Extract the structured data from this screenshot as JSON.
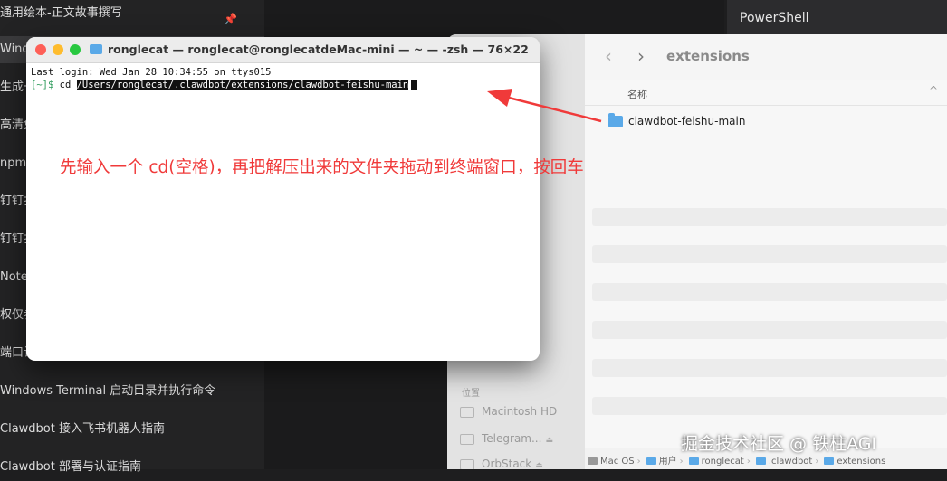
{
  "left_panel": {
    "items": [
      {
        "label": "通用绘本-正文故事撰写"
      },
      {
        "label": "Wind"
      },
      {
        "label": "生成一"
      },
      {
        "label": "高清免"
      },
      {
        "label": "npm"
      },
      {
        "label": "钉钉扌"
      },
      {
        "label": "钉钉扌"
      },
      {
        "label": "Notel"
      },
      {
        "label": "权仅参"
      },
      {
        "label": "端口认"
      },
      {
        "label": "Windows Terminal 启动目录并执行命令"
      },
      {
        "label": "Clawdbot 接入飞书机器人指南"
      },
      {
        "label": "Clawdbot 部署与认证指南"
      }
    ],
    "pin_icon": "pin-icon"
  },
  "powershell_tab": {
    "label": "PowerShell"
  },
  "terminal": {
    "title": "ronglecat — ronglecat@ronglecatdeMac-mini — ~ — -zsh — 76×22",
    "last_login": "Last login: Wed Jan 28 10:34:55 on ttys015",
    "prompt": "[~]$",
    "command": "cd",
    "selected_path": "/Users/ronglecat/.clawdbot/extensions/clawdbot-feishu-main"
  },
  "annotation": {
    "text": "先输入一个 cd(空格)，再把解压出来的文件夹拖动到终端窗口，按回车",
    "color": "#f03a3a"
  },
  "finder": {
    "title": "extensions",
    "back_icon": "chevron-left-icon",
    "forward_icon": "chevron-right-icon",
    "column_header": "名称",
    "folder_name": "clawdbot-feishu-main",
    "sidebar_section": "位置",
    "sidebar_items": [
      {
        "label": "Macintosh HD"
      },
      {
        "label": "Telegram..."
      },
      {
        "label": "OrbStack"
      }
    ],
    "path": [
      {
        "label": "Mac OS"
      },
      {
        "label": "用户"
      },
      {
        "label": "ronglecat"
      },
      {
        "label": ".clawdbot"
      },
      {
        "label": "extensions"
      }
    ]
  },
  "watermark": {
    "text": "掘金技术社区 @ 铁柱AGI"
  }
}
